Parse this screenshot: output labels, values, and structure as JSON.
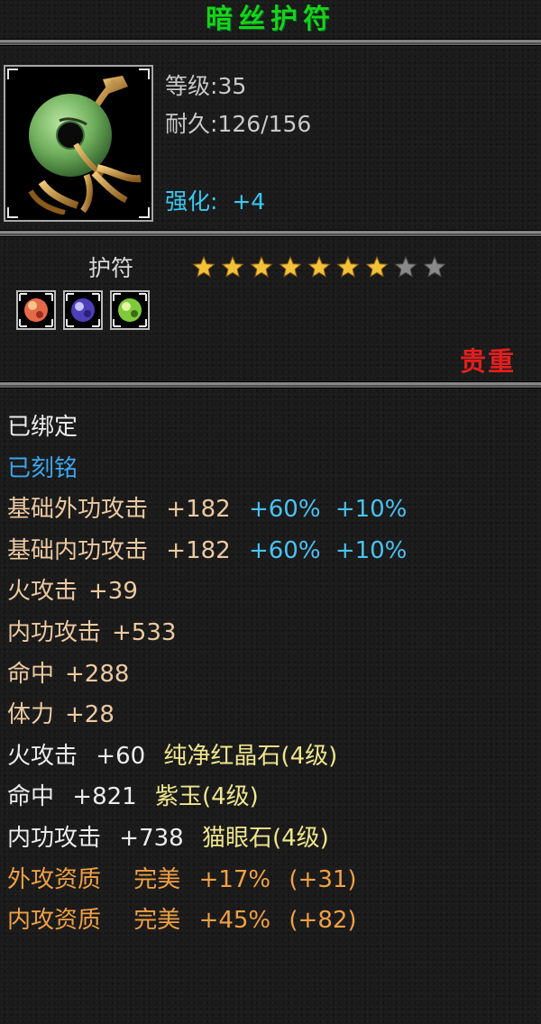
{
  "item": {
    "name": "暗丝护符",
    "level_label": "等级",
    "level": "35",
    "durability_label": "耐久",
    "durability": "126/156",
    "enhance_label": "强化:",
    "enhance_value": "+4",
    "type": "护符",
    "stars_filled": 7,
    "stars_total": 9,
    "rarity": "贵重"
  },
  "gems": [
    {
      "icon": "red-crystal-gem-icon",
      "color": "#e46a48"
    },
    {
      "icon": "purple-jade-gem-icon",
      "color": "#6a5ae0"
    },
    {
      "icon": "cats-eye-gem-icon",
      "color": "#7fca3a"
    }
  ],
  "colors": {
    "title": "#18d418",
    "enhance": "#3bc8f0",
    "rarity": "#e21f1f",
    "bound": "#ececec",
    "engraved": "#3ba7ee",
    "base_attr": "#ecc9a0",
    "percent": "#49c3f3",
    "gem_name": "#efe68c",
    "quality": "#f0a043"
  },
  "status": {
    "bound": "已绑定",
    "engraved": "已刻铭"
  },
  "attributes": [
    {
      "name": "基础外功攻击",
      "value": "+182",
      "pct1": "+60%",
      "pct2": "+10%"
    },
    {
      "name": "基础内功攻击",
      "value": "+182",
      "pct1": "+60%",
      "pct2": "+10%"
    },
    {
      "name": "火攻击",
      "value": "+39"
    },
    {
      "name": "内功攻击",
      "value": "+533"
    },
    {
      "name": "命中",
      "value": "+288"
    },
    {
      "name": "体力",
      "value": "+28"
    }
  ],
  "gem_attributes": [
    {
      "name": "火攻击",
      "value": "+60",
      "gem": "纯净红晶石(4级)"
    },
    {
      "name": "命中",
      "value": "+821",
      "gem": "紫玉(4级)"
    },
    {
      "name": "内功攻击",
      "value": "+738",
      "gem": "猫眼石(4级)"
    }
  ],
  "qualities": [
    {
      "name": "外攻资质",
      "grade": "完美",
      "pct": "+17%",
      "bonus": "(+31)"
    },
    {
      "name": "内攻资质",
      "grade": "完美",
      "pct": "+45%",
      "bonus": "(+82)"
    }
  ]
}
